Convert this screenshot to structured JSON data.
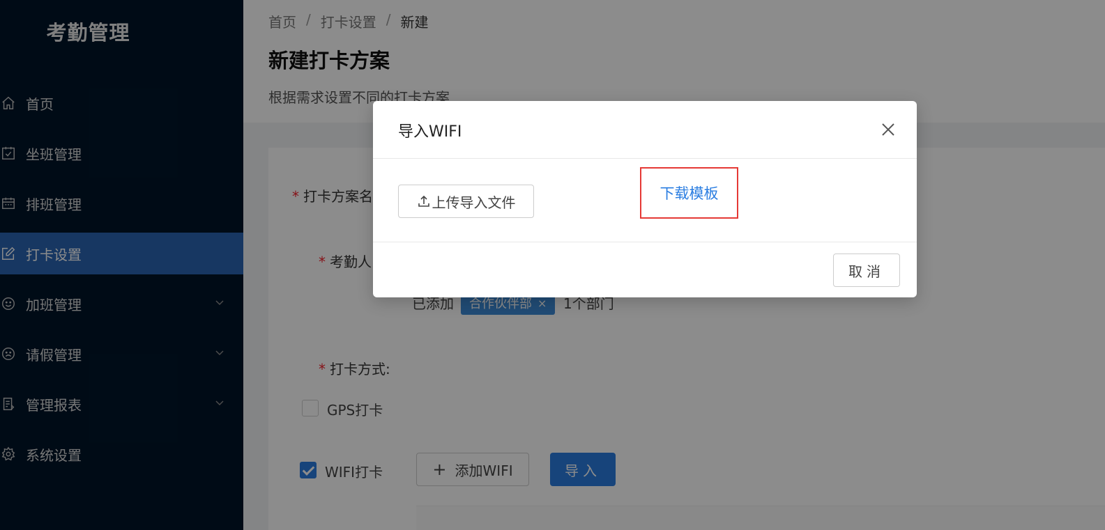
{
  "sidebar": {
    "logo": "考勤管理",
    "items": [
      {
        "label": "首页",
        "icon": "home-icon",
        "active": false,
        "has_children": false
      },
      {
        "label": "坐班管理",
        "icon": "calendar-check-icon",
        "active": false,
        "has_children": false
      },
      {
        "label": "排班管理",
        "icon": "schedule-icon",
        "active": false,
        "has_children": false
      },
      {
        "label": "打卡设置",
        "icon": "edit-icon",
        "active": true,
        "has_children": false
      },
      {
        "label": "加班管理",
        "icon": "smile-icon",
        "active": false,
        "has_children": true
      },
      {
        "label": "请假管理",
        "icon": "frown-icon",
        "active": false,
        "has_children": true
      },
      {
        "label": "管理报表",
        "icon": "report-icon",
        "active": false,
        "has_children": true
      },
      {
        "label": "系统设置",
        "icon": "gear-icon",
        "active": false,
        "has_children": false
      }
    ]
  },
  "breadcrumb": {
    "items": [
      "首页",
      "打卡设置",
      "新建"
    ],
    "separator": "/"
  },
  "page": {
    "title": "新建打卡方案",
    "description": "根据需求设置不同的打卡方案"
  },
  "form": {
    "name_label": "打卡方案名",
    "people_label": "考勤人",
    "added_prefix": "已添加",
    "dept_tag": "合作伙伴部",
    "dept_tag_close": "×",
    "dept_count": "1个部门",
    "method_label": "打卡方式:",
    "gps_label": "GPS打卡",
    "gps_checked": false,
    "wifi_label": "WIFI打卡",
    "wifi_checked": true,
    "add_wifi_button": "添加WIFI",
    "import_button": "导入"
  },
  "modal": {
    "title": "导入WIFI",
    "upload_button": "上传导入文件",
    "download_link": "下载模板",
    "cancel_button": "取消"
  },
  "colors": {
    "sidebar_bg": "#001529",
    "active_menu": "#2a64b2",
    "primary": "#2a7de1",
    "highlight_border": "#e53935"
  }
}
